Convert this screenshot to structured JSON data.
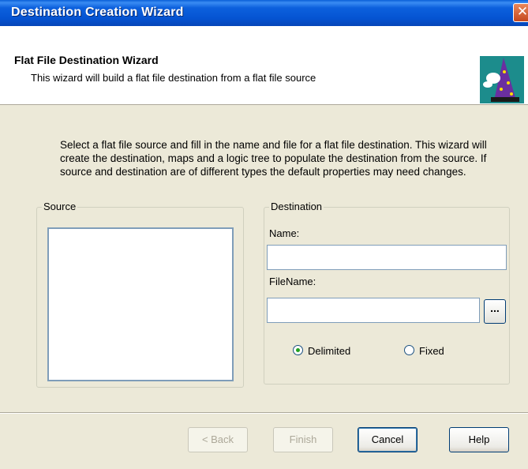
{
  "window": {
    "title": "Destination Creation Wizard"
  },
  "header": {
    "title": "Flat File Destination Wizard",
    "subtitle": "This wizard will build a flat file destination from a flat file source"
  },
  "description": "Select a flat file source and fill in the name and file for a flat file destination. This wizard will create the destination, maps and a logic tree to populate the destination from the source. If source and destination are of different types the default properties may need changes.",
  "source": {
    "label": "Source",
    "items": []
  },
  "destination": {
    "label": "Destination",
    "name_label": "Name:",
    "name_value": "",
    "filename_label": "FileName:",
    "filename_value": "",
    "browse_label": "...",
    "format_options": [
      {
        "label": "Delimited",
        "selected": true
      },
      {
        "label": "Fixed",
        "selected": false
      }
    ]
  },
  "buttons": {
    "back": "< Back",
    "finish": "Finish",
    "cancel": "Cancel",
    "help": "Help"
  },
  "icons": {
    "close": "close-icon",
    "wizard": "wizard-icon"
  },
  "colors": {
    "titlebar": "#0554d2",
    "dialog_bg": "#ece9d8",
    "icon_bg": "#1c8c8c"
  }
}
